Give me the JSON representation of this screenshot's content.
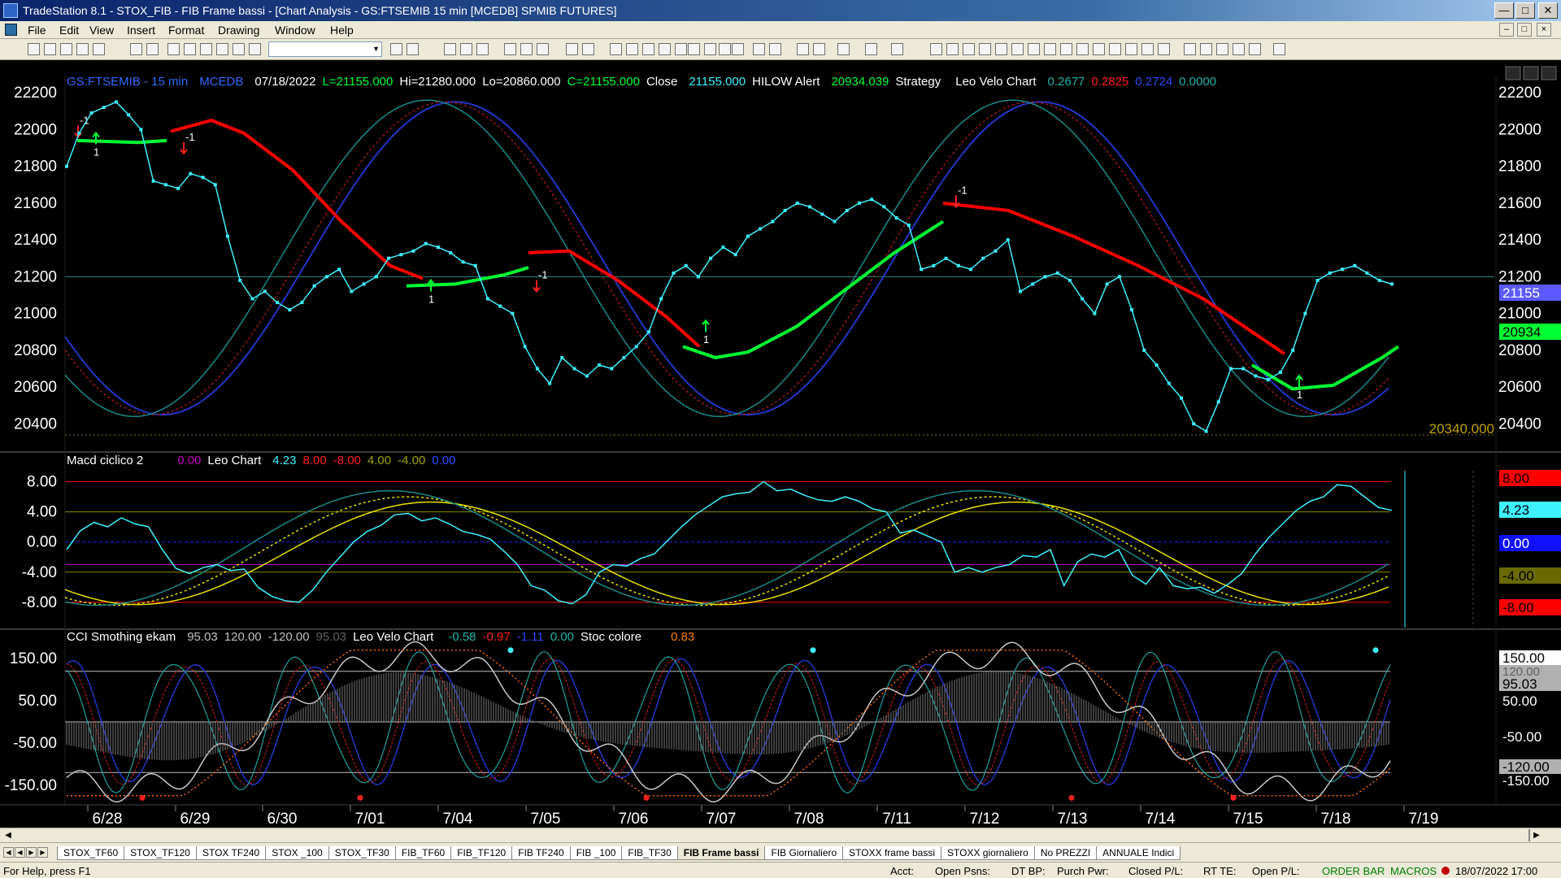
{
  "window": {
    "title": "TradeStation 8.1 - STOX_FIB - FIB Frame bassi - [Chart Analysis - GS:FTSEMIB  15 min  [MCEDB] SPMIB FUTURES]"
  },
  "menu": [
    "File",
    "Edit",
    "View",
    "Insert",
    "Format",
    "Drawing",
    "Window",
    "Help"
  ],
  "colors": {
    "price_bars": "#3ff0ff",
    "green_line": "#00ff33",
    "red_line": "#ff0000",
    "grid": "#2a6a6a",
    "background": "#000000"
  },
  "chart_data": [
    {
      "type": "line",
      "panel": "price",
      "header": {
        "symbol": "GS:FTSEMIB - 15 min",
        "source": "MCEDB",
        "date": "07/18/2022",
        "last": "L=21155.000",
        "high": "Hi=21280.000",
        "low": "Lo=20860.000",
        "close_c": "C=21155.000",
        "close_label": "Close",
        "close_value": "21155.000",
        "hilow_label": "HILOW Alert",
        "hilow_value": "20934.039",
        "strategy": "Strategy",
        "velo_label": "Leo Velo Chart",
        "velo_v1": "0.2677",
        "velo_v2": "0.2825",
        "velo_v3": "0.2724",
        "velo_v4": "0.0000"
      },
      "ylim": [
        20300,
        22280
      ],
      "yticks": [
        "22200",
        "22000",
        "21800",
        "21600",
        "21400",
        "21200",
        "21000",
        "20800",
        "20600",
        "20400"
      ],
      "price_marker": "21155",
      "hilow_marker": "20934",
      "last_low_label": "20340.000",
      "series": [
        {
          "values": [
            21800,
            21980,
            22090,
            22120,
            22150,
            22080,
            22000,
            21720,
            21700,
            21680,
            21760,
            21740,
            21700,
            21420,
            21180,
            21080,
            21120,
            21060,
            21020,
            21060,
            21150,
            21200,
            21240,
            21120,
            21160,
            21200,
            21300,
            21320,
            21340,
            21380,
            21360,
            21330,
            21280,
            21260,
            21080,
            21040,
            21000,
            20820,
            20700,
            20620,
            20760,
            20700,
            20660,
            20720,
            20700,
            20760,
            20820,
            20900,
            21080,
            21220,
            21260,
            21200,
            21300,
            21360,
            21320,
            21420,
            21460,
            21500,
            21560,
            21600,
            21580,
            21540,
            21500,
            21560,
            21600,
            21620,
            21580,
            21520,
            21480,
            21240,
            21260,
            21300,
            21260,
            21240,
            21300,
            21340,
            21400,
            21120,
            21160,
            21200,
            21220,
            21180,
            21080,
            21000,
            21160,
            21200,
            21020,
            20800,
            20720,
            20620,
            20540,
            20400,
            20360,
            20520,
            20700,
            20700,
            20660,
            20640,
            20680,
            20800,
            21000,
            21180,
            21220,
            21240,
            21260,
            21220,
            21180,
            21160
          ]
        }
      ]
    },
    {
      "type": "line",
      "panel": "macd",
      "header": {
        "name": "Macd ciclico 2",
        "v1": "0.00",
        "leo": "Leo Chart",
        "v2": "4.23",
        "v3": "8.00",
        "v4": "-8.00",
        "v5": "4.00",
        "v6": "-4.00",
        "v7": "0.00"
      },
      "ylim": [
        -10.5,
        10.0
      ],
      "yticks": [
        "8.00",
        "4.00",
        "0.00",
        "-4.00",
        "-8.00"
      ],
      "labels": {
        "max": "8.00",
        "current": "4.23",
        "zero": "0.00",
        "neg4": "-4.00",
        "min": "-8.00"
      },
      "series": [
        {
          "values": [
            -1.0,
            1.5,
            2.6,
            2.0,
            3.2,
            2.4,
            2.0,
            -1.0,
            -3.5,
            -4.2,
            -3.4,
            -3.0,
            -3.8,
            -3.6,
            -6.0,
            -7.2,
            -7.8,
            -8.0,
            -6.4,
            -4.0,
            -2.0,
            0.0,
            1.4,
            2.2,
            3.6,
            3.8,
            2.8,
            3.2,
            2.4,
            1.4,
            1.0,
            0.4,
            -1.2,
            -3.0,
            -5.8,
            -6.4,
            -7.8,
            -8.2,
            -7.0,
            -4.0,
            -3.0,
            -3.2,
            -2.2,
            -1.6,
            0.2,
            2.0,
            3.6,
            4.8,
            6.0,
            6.4,
            6.6,
            8.0,
            6.8,
            7.0,
            6.2,
            5.6,
            5.4,
            6.0,
            5.4,
            4.4,
            4.0,
            1.2,
            1.6,
            0.8,
            0.0,
            -4.0,
            -3.4,
            -4.0,
            -3.4,
            -3.0,
            -1.8,
            -2.0,
            -1.0,
            -5.8,
            -2.6,
            -1.6,
            -2.0,
            -1.0,
            -4.4,
            -5.6,
            -3.4,
            -5.8,
            -6.2,
            -6.0,
            -6.8,
            -5.6,
            -4.2,
            -1.6,
            0.6,
            2.4,
            4.2,
            5.4,
            6.0,
            7.6,
            7.4,
            6.0,
            4.6,
            4.2
          ]
        }
      ]
    },
    {
      "type": "line",
      "panel": "cci",
      "header": {
        "name": "CCI Smothing ekam",
        "v1": "95.03",
        "v2": "120.00",
        "v3": "-120.00",
        "v4": "95.03",
        "velo": "Leo Velo Chart",
        "v5": "-0.58",
        "v6": "-0.97",
        "v7": "-1.11",
        "v8": "0.00",
        "stoc": "Stoc colore",
        "v9": "0.83"
      },
      "ylim": [
        -185,
        185
      ],
      "yticks": [
        "150.00",
        "50.00",
        "-50.00",
        "-150.00"
      ],
      "labels": {
        "top": "150.00",
        "upper": "120.00",
        "current": "95.03",
        "mid": "50.00",
        "neg50": "-50.00",
        "lower": "-120.00",
        "bottom": "-150.00"
      }
    }
  ],
  "xaxis": {
    "ticks": [
      "6/28",
      "6/29",
      "6/30",
      "7/01",
      "7/04",
      "7/05",
      "7/06",
      "7/07",
      "7/08",
      "7/11",
      "7/12",
      "7/13",
      "7/14",
      "7/15",
      "7/18",
      "7/19"
    ]
  },
  "sheet_tabs": [
    "STOX_TF60",
    "STOX_TF120",
    "STOX TF240",
    "STOX _100",
    "STOX_TF30",
    "FIB_TF60",
    "FIB_TF120",
    "FIB TF240",
    "FIB _100",
    "FIB_TF30",
    "FIB Frame bassi",
    "FIB Giornaliero",
    "STOXX frame bassi",
    "STOXX giornaliero",
    "No PREZZI",
    "ANNUALE Indici"
  ],
  "active_tab": "FIB Frame bassi",
  "statusbar": {
    "help": "For Help, press F1",
    "acct": "Acct:",
    "open_psns": "Open Psns:",
    "dt_bp": "DT BP:",
    "purch_pwr": "Purch Pwr:",
    "closed_pl": "Closed P/L:",
    "rt_te": "RT TE:",
    "open_pl": "Open P/L:",
    "order_bar": "ORDER BAR",
    "macros": "MACROS",
    "datetime": "18/07/2022 17:00"
  }
}
